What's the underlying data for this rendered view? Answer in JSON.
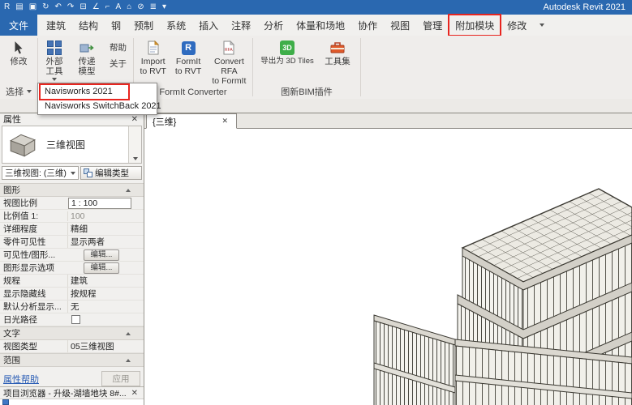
{
  "glyphs": {
    "close": "✕"
  },
  "titlebar": {
    "title": "Autodesk Revit 2021",
    "icons": [
      {
        "name": "revit-menu-icon",
        "glyph": "R"
      },
      {
        "name": "open-icon",
        "glyph": "▤"
      },
      {
        "name": "save-icon",
        "glyph": "▣"
      },
      {
        "name": "sync-icon",
        "glyph": "↻"
      },
      {
        "name": "undo-icon",
        "glyph": "↶"
      },
      {
        "name": "redo-icon",
        "glyph": "↷"
      },
      {
        "name": "print-icon",
        "glyph": "⊟"
      },
      {
        "name": "measure-icon",
        "glyph": "∠"
      },
      {
        "name": "dimension-icon",
        "glyph": "⌐"
      },
      {
        "name": "text-icon",
        "glyph": "A"
      },
      {
        "name": "default-3d-view-icon",
        "glyph": "⌂"
      },
      {
        "name": "section-icon",
        "glyph": "⊘"
      },
      {
        "name": "thin-lines-icon",
        "glyph": "≣"
      },
      {
        "name": "user-menu-icon",
        "glyph": "▾"
      }
    ]
  },
  "tabs": [
    {
      "label": "文件",
      "name": "tab-file",
      "cls": "file"
    },
    {
      "label": "建筑",
      "name": "tab-architecture"
    },
    {
      "label": "结构",
      "name": "tab-structure"
    },
    {
      "label": "钢",
      "name": "tab-steel"
    },
    {
      "label": "预制",
      "name": "tab-precast"
    },
    {
      "label": "系统",
      "name": "tab-systems"
    },
    {
      "label": "插入",
      "name": "tab-insert"
    },
    {
      "label": "注释",
      "name": "tab-annotate"
    },
    {
      "label": "分析",
      "name": "tab-analyze"
    },
    {
      "label": "体量和场地",
      "name": "tab-massing-site"
    },
    {
      "label": "协作",
      "name": "tab-collaborate"
    },
    {
      "label": "视图",
      "name": "tab-view"
    },
    {
      "label": "管理",
      "name": "tab-manage"
    },
    {
      "label": "附加模块",
      "name": "tab-addins",
      "cls": "boxed"
    },
    {
      "label": "修改",
      "name": "tab-modify"
    }
  ],
  "ribbon": {
    "modify_label": "修改",
    "select_panel_label": "选择",
    "external_tools_line1": "外部",
    "external_tools_line2": "工具",
    "transfer_line1": "传递",
    "transfer_line2": "模型",
    "help_label": "帮助",
    "about_label": "关于",
    "import_line1": "Import",
    "import_line2": "to RVT",
    "formit_line1": "FormIt",
    "formit_line2": "to RVT",
    "convert_line1": "Convert RFA",
    "convert_line2": "to FormIt",
    "formit_panel_label": "FormIt Converter",
    "export_tiles_label": "导出为 3D Tiles",
    "export_icon_text": "3D",
    "formit_icon_text": "R",
    "toolset_label": "工具集",
    "bim_panel_label": "图新BIM插件"
  },
  "dropdown": {
    "items": [
      {
        "label": "Navisworks 2021",
        "name": "menu-item-navisworks-2021",
        "cls": "boxed"
      },
      {
        "label": "Navisworks SwitchBack 2021",
        "name": "menu-item-navisworks-switchback-2021"
      }
    ]
  },
  "properties": {
    "panel_title": "属性",
    "type_label": "三维视图",
    "selector_value": "三维视图: (三维)",
    "edit_type_label": "编辑类型",
    "grid": [
      {
        "kind": "section",
        "label": "图形"
      },
      {
        "kind": "row",
        "label": "视图比例",
        "value": "1 : 100",
        "vkind": "cell"
      },
      {
        "kind": "row",
        "label": "比例值 1:",
        "value": "100",
        "vkind": "dim"
      },
      {
        "kind": "row",
        "label": "详细程度",
        "value": "精细"
      },
      {
        "kind": "row",
        "label": "零件可见性",
        "value": "显示两者"
      },
      {
        "kind": "row",
        "label": "可见性/图形...",
        "value": "编辑...",
        "vkind": "button"
      },
      {
        "kind": "row",
        "label": "图形显示选项",
        "value": "编辑...",
        "vkind": "button"
      },
      {
        "kind": "row",
        "label": "规程",
        "value": "建筑"
      },
      {
        "kind": "row",
        "label": "显示隐藏线",
        "value": "按规程"
      },
      {
        "kind": "row",
        "label": "默认分析显示...",
        "value": "无"
      },
      {
        "kind": "row",
        "label": "日光路径",
        "value": "",
        "vkind": "check"
      },
      {
        "kind": "section",
        "label": "文字"
      },
      {
        "kind": "row",
        "label": "视图类型",
        "value": "05三维视图"
      },
      {
        "kind": "section",
        "label": "范围"
      }
    ],
    "help_link": "属性帮助",
    "apply_label": "应用",
    "browser_title": "项目浏览器 - 升级-湖墙地块 8#..."
  },
  "canvas": {
    "view_tab_label": "{三维}"
  }
}
